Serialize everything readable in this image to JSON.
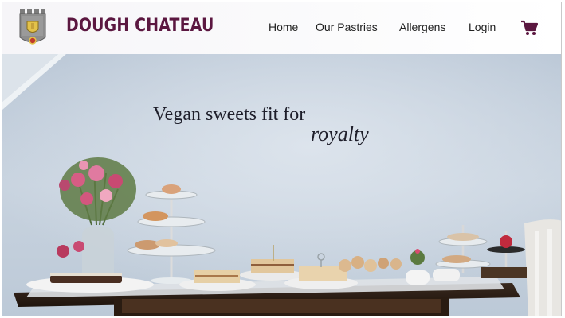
{
  "brand": {
    "name": "DOUGH CHATEAU",
    "logo_icon": "castle-icon",
    "color": "#5b1740"
  },
  "nav": {
    "items": [
      {
        "label": "Home"
      },
      {
        "label": "Our Pastries"
      },
      {
        "label": "Allergens"
      },
      {
        "label": "Login"
      }
    ],
    "cart_icon": "shopping-cart-icon",
    "cart_color": "#5b1740"
  },
  "hero": {
    "tagline_line1": "Vegan sweets fit for",
    "tagline_line2": "royalty",
    "image": "photo of a dessert table with cake stands, pastries and flowers"
  }
}
